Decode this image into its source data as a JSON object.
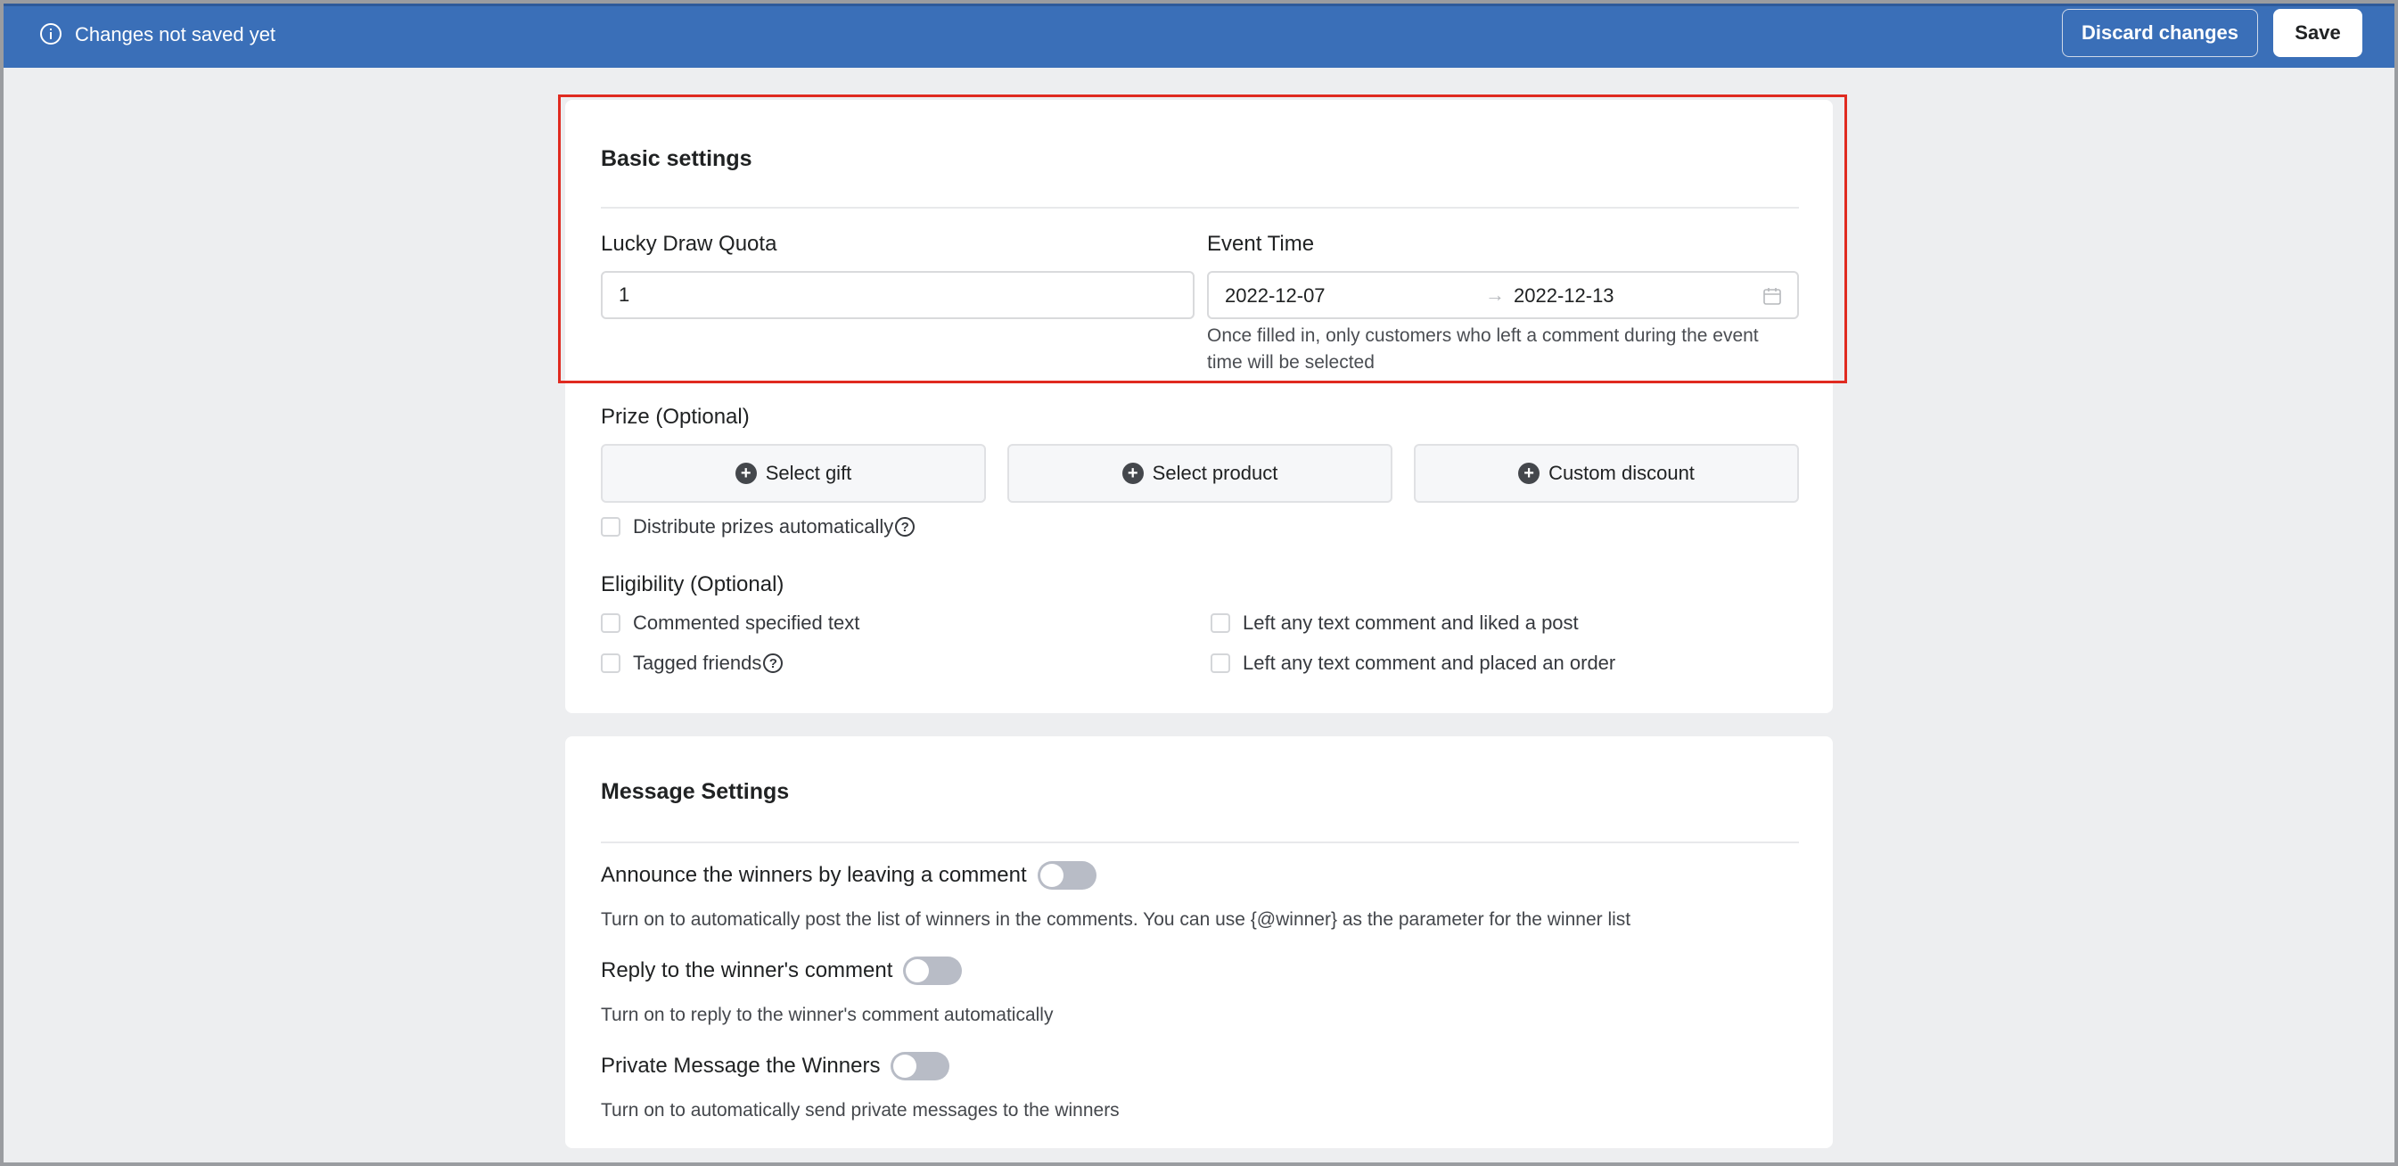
{
  "topbar": {
    "status": "Changes not saved yet",
    "discard_label": "Discard changes",
    "save_label": "Save",
    "bg_color": "#3a6fb8"
  },
  "basic": {
    "title": "Basic settings",
    "quota_label": "Lucky Draw Quota",
    "quota_value": "1",
    "event_time_label": "Event Time",
    "event_start": "2022-12-07",
    "event_end": "2022-12-13",
    "event_help_line1": "Once filled in, only customers who left a comment during the event",
    "event_help_line2": "time will be selected",
    "prize_label": "Prize (Optional)",
    "prize_buttons": [
      "Select gift",
      "Select product",
      "Custom discount"
    ],
    "distribute_label": "Distribute prizes automatically",
    "eligibility_label": "Eligibility (Optional)",
    "eligibility": [
      "Commented specified text",
      "Left any text comment and liked a post",
      "Tagged friends",
      "Left any text comment and placed an order"
    ]
  },
  "message": {
    "title": "Message Settings",
    "toggles": [
      {
        "label": "Announce the winners by leaving a comment",
        "desc": "Turn on to automatically post the list of winners in the comments. You can use {@winner} as the parameter for the winner list",
        "on": false
      },
      {
        "label": "Reply to the winner's comment",
        "desc": "Turn on to reply to the winner's comment automatically",
        "on": false
      },
      {
        "label": "Private Message the Winners",
        "desc": "Turn on to automatically send private messages to the winners",
        "on": false
      }
    ]
  },
  "colors": {
    "highlight": "#e02a20",
    "toggle_off": "#b8bcc6"
  }
}
